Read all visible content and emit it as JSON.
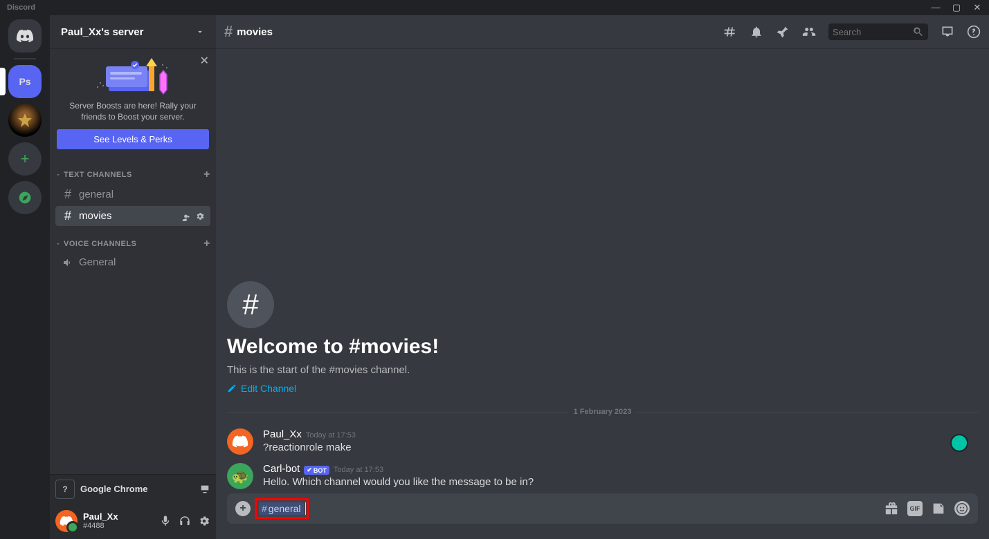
{
  "titlebar": {
    "app": "Discord"
  },
  "server": {
    "name": "Paul_Xx's server",
    "ps_label": "Ps"
  },
  "boost": {
    "text": "Server Boosts are here! Rally your friends to Boost your server.",
    "button": "See Levels & Perks"
  },
  "categories": {
    "text": "TEXT CHANNELS",
    "voice": "VOICE CHANNELS"
  },
  "channels": {
    "general": "general",
    "movies": "movies",
    "voice_general": "General"
  },
  "header": {
    "channel": "movies",
    "search_placeholder": "Search"
  },
  "welcome": {
    "title": "Welcome to #movies!",
    "subtitle": "This is the start of the #movies channel.",
    "edit": "Edit Channel"
  },
  "date_divider": "1 February 2023",
  "messages": [
    {
      "user": "Paul_Xx",
      "timestamp": "Today at 17:53",
      "text": "?reactionrole make",
      "bot": false
    },
    {
      "user": "Carl-bot",
      "timestamp": "Today at 17:53",
      "text": "Hello. Which channel would you like the message to be in?",
      "bot": true,
      "bot_label": "BOT"
    }
  ],
  "input": {
    "mention": "general"
  },
  "streaming": {
    "name": "Google Chrome",
    "icon_label": "?"
  },
  "user": {
    "name": "Paul_Xx",
    "tag": "#4488"
  },
  "icon_text": {
    "gif": "GIF"
  }
}
